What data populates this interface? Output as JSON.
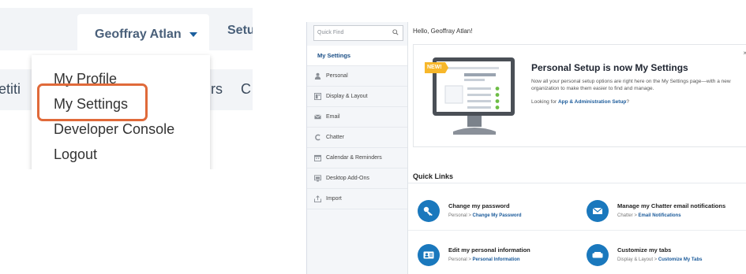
{
  "dropdown": {
    "user_name": "Geoffray Atlan",
    "setup_tab": "Setu",
    "background_left": "etiti",
    "background_mid": "rs",
    "background_right": "C",
    "items": [
      "My Profile",
      "My Settings",
      "Developer Console",
      "Logout"
    ],
    "highlight_color": "#e06a3a"
  },
  "settings_page": {
    "search_placeholder": "Quick Find",
    "greeting": "Hello, Geoffray Atlan!",
    "sidebar": [
      {
        "label": "My Settings",
        "icon": "none",
        "active": true
      },
      {
        "label": "Personal",
        "icon": "person-icon"
      },
      {
        "label": "Display & Layout",
        "icon": "layout-icon"
      },
      {
        "label": "Email",
        "icon": "email-icon"
      },
      {
        "label": "Chatter",
        "icon": "chatter-icon"
      },
      {
        "label": "Calendar & Reminders",
        "icon": "calendar-icon"
      },
      {
        "label": "Desktop Add-Ons",
        "icon": "desktop-icon"
      },
      {
        "label": "Import",
        "icon": "import-icon"
      }
    ],
    "promo": {
      "badge": "NEW!",
      "title": "Personal Setup is now My Settings",
      "description": "Now all your personal setup options are right here on the My Settings page—with a new organization to make them easier to find and manage.",
      "link_prefix": "Looking for",
      "link_text": "App & Administration Setup",
      "link_suffix": "?",
      "close": "×"
    },
    "quick_links_title": "Quick Links",
    "quick_links": [
      {
        "title": "Change my password",
        "crumb_prefix": "Personal > ",
        "crumb_link": "Change My Password",
        "icon": "key-icon"
      },
      {
        "title": "Manage my Chatter email notifications",
        "crumb_prefix": "Chatter > ",
        "crumb_link": "Email Notifications",
        "icon": "envelope-icon"
      },
      {
        "title": "Edit my personal information",
        "crumb_prefix": "Personal > ",
        "crumb_link": "Personal Information",
        "icon": "id-card-icon"
      },
      {
        "title": "Customize my tabs",
        "crumb_prefix": "Display & Layout > ",
        "crumb_link": "Customize My Tabs",
        "icon": "tabs-icon"
      }
    ],
    "accent_color": "#1a78bd"
  }
}
